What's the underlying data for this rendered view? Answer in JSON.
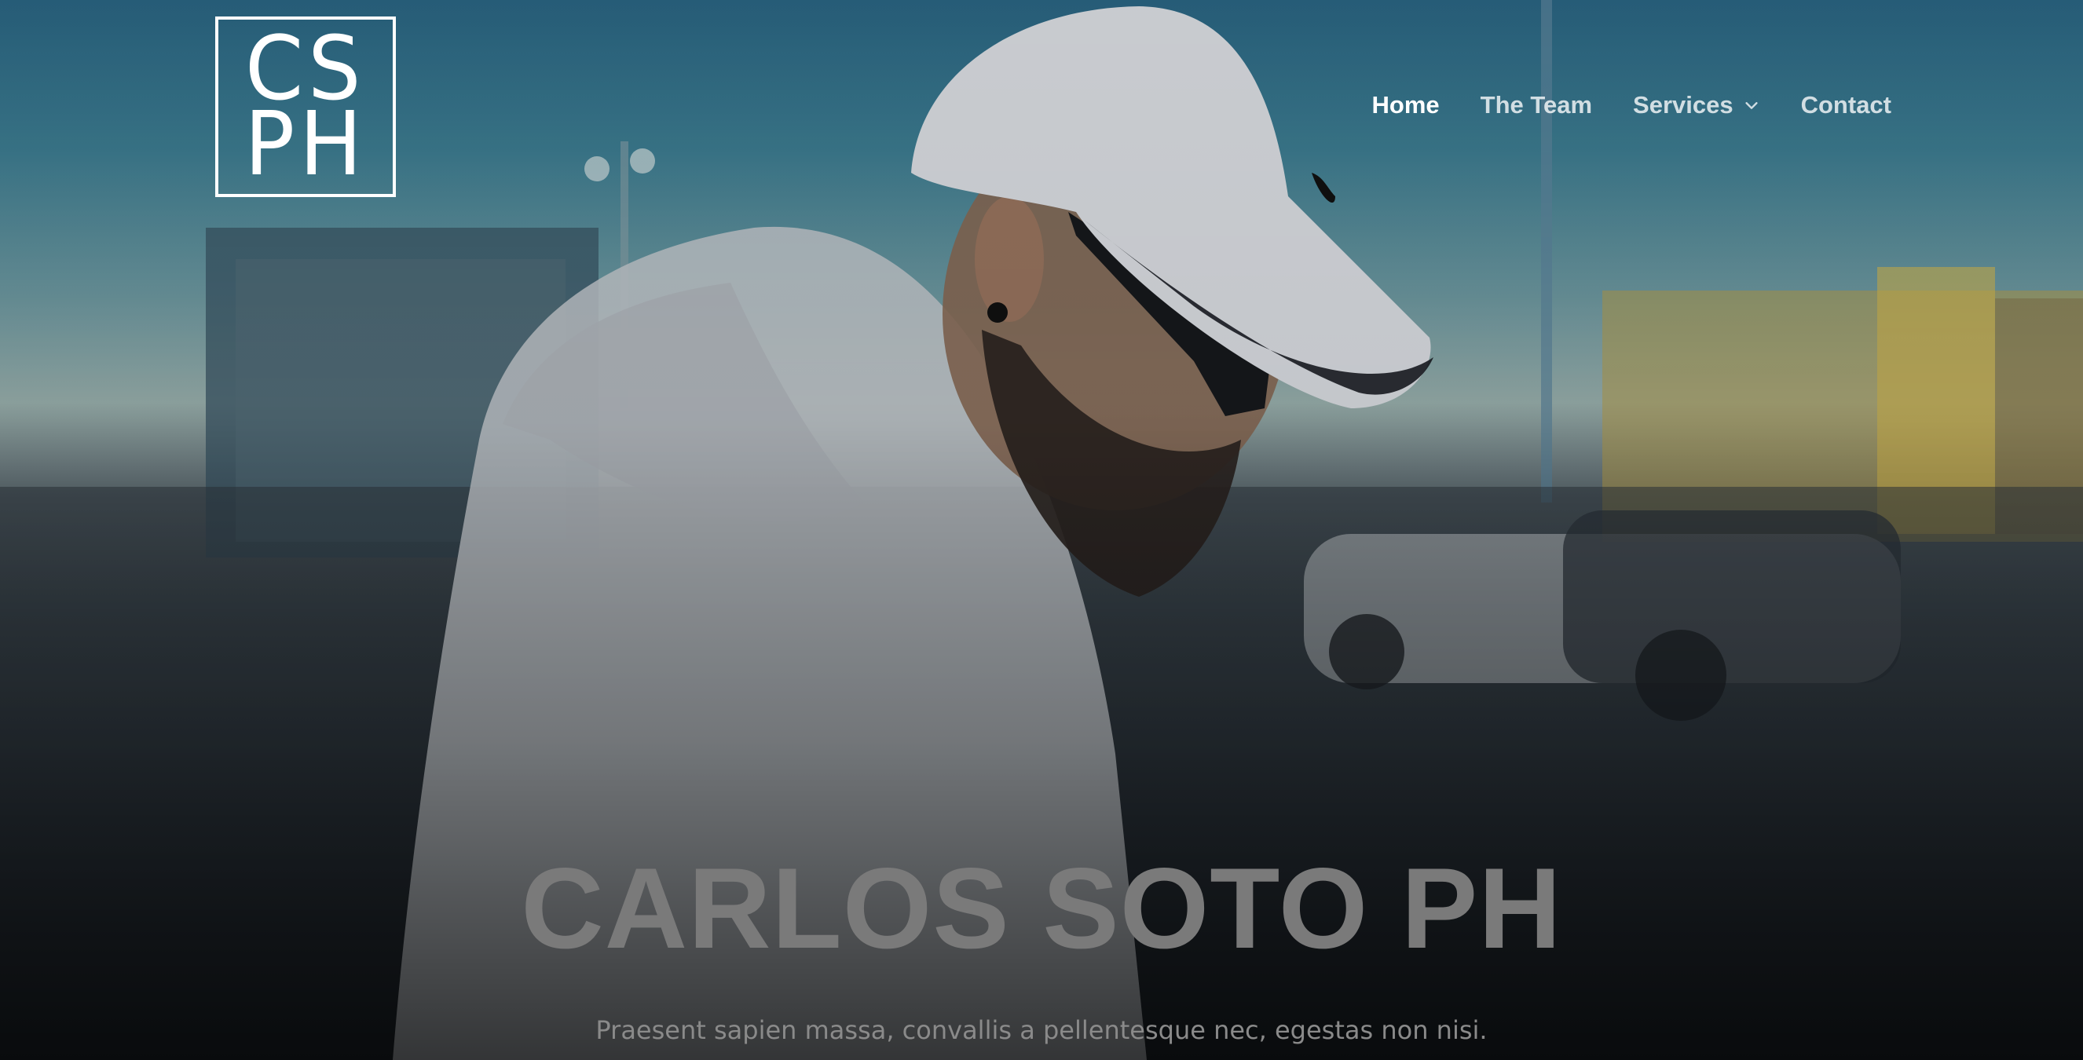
{
  "logo": {
    "line1": "CS",
    "line2": "PH"
  },
  "nav": {
    "items": [
      {
        "label": "Home",
        "active": true
      },
      {
        "label": "The Team",
        "active": false
      },
      {
        "label": "Services",
        "active": false,
        "has_dropdown": true
      },
      {
        "label": "Contact",
        "active": false
      }
    ]
  },
  "hero": {
    "title": "CARLOS SOTO PH",
    "subtitle": "Praesent sapien massa, convallis a pellentesque nec, egestas non nisi."
  },
  "icons": {
    "services_dropdown": "chevron-down-icon"
  },
  "colors": {
    "nav_active": "#ffffff",
    "nav_inactive": "#c7cdd2",
    "hero_title": "#7a7a7a",
    "hero_subtitle": "#8a8a8a",
    "sky_top": "#2a6684"
  }
}
